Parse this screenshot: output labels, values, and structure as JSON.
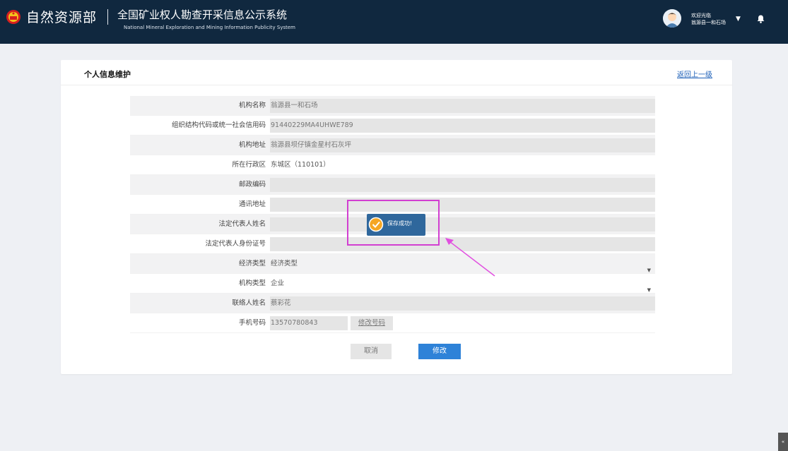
{
  "header": {
    "brand": "自然资源部",
    "system_title_cn": "全国矿业权人勘查开采信息公示系统",
    "system_title_en": "National Mineral Exploration and Mining Information Publicity System",
    "welcome_line1": "欢迎光临",
    "welcome_line2": "翁源县一和石场"
  },
  "page": {
    "title": "个人信息维护",
    "back_link": "返回上一级"
  },
  "form": {
    "rows": [
      {
        "label": "机构名称",
        "value": "翁源县一和石场"
      },
      {
        "label": "组织结构代码或统一社会信用码",
        "value": "91440229MA4UHWE789"
      },
      {
        "label": "机构地址",
        "value": "翁源县坝仔镇金星村石灰坪"
      },
      {
        "label": "所在行政区",
        "value": "东城区（110101）"
      },
      {
        "label": "邮政编码",
        "value": ""
      },
      {
        "label": "通讯地址",
        "value": ""
      },
      {
        "label": "法定代表人姓名",
        "value": ""
      },
      {
        "label": "法定代表人身份证号",
        "value": ""
      },
      {
        "label": "经济类型",
        "value": "经济类型"
      },
      {
        "label": "机构类型",
        "value": "企业"
      },
      {
        "label": "联络人姓名",
        "value": "蔡彩花"
      },
      {
        "label": "手机号码",
        "value": "13570780843"
      }
    ],
    "change_phone": "修改号码",
    "cancel": "取消",
    "modify": "修改"
  },
  "toast": {
    "message": "保存成功!"
  },
  "colors": {
    "header_bg": "#10283f",
    "primary": "#2e82d8",
    "link": "#1e60b8",
    "annotation": "#d23fd1",
    "toast_bg": "#2f679c"
  },
  "icons": [
    "national-emblem-icon",
    "avatar-icon",
    "caret-down-icon",
    "bell-icon",
    "check-circle-icon",
    "arrow-annotation-icon",
    "scroll-top-icon"
  ]
}
